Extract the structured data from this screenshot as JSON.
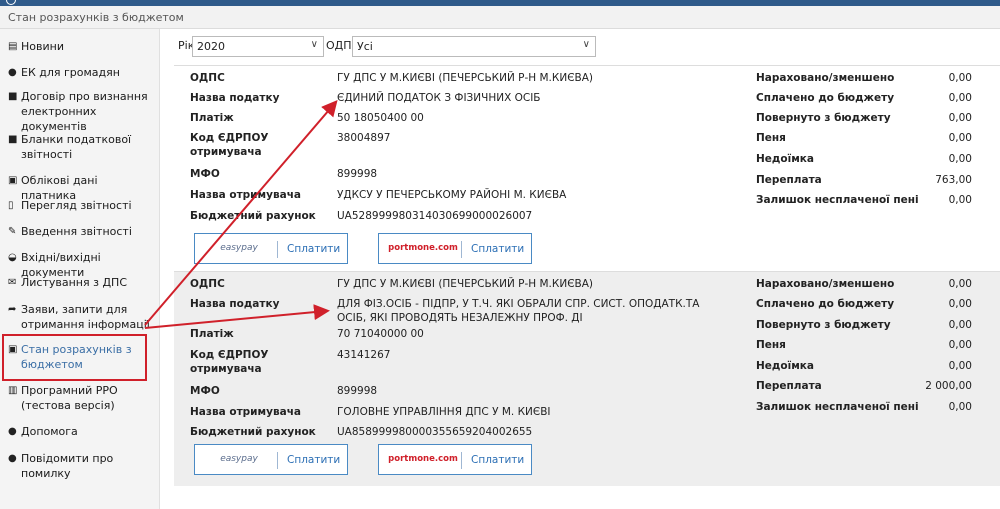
{
  "app": {
    "page_title": "Стан розрахунків з бюджетом"
  },
  "sidebar": {
    "items": [
      {
        "label": "Новини",
        "icon": "newspaper-icon"
      },
      {
        "label": "ЕК для громадян",
        "icon": "user-icon"
      },
      {
        "label": "Договір про визнання електронних документів",
        "icon": "document-icon"
      },
      {
        "label": "Бланки податкової звітності",
        "icon": "book-icon"
      },
      {
        "label": "Облікові дані платника",
        "icon": "id-card-icon"
      },
      {
        "label": "Перегляд звітності",
        "icon": "file-icon"
      },
      {
        "label": "Введення звітності",
        "icon": "edit-icon"
      },
      {
        "label": "Вхідні/вихідні документи",
        "icon": "inbox-icon"
      },
      {
        "label": "Листування з ДПС",
        "icon": "envelope-icon"
      },
      {
        "label": "Заяви, запити для отримання інформації",
        "icon": "share-icon"
      },
      {
        "label": "Стан розрахунків з бюджетом",
        "icon": "money-icon"
      },
      {
        "label": "Програмний РРО (тестова версія)",
        "icon": "printer-icon"
      },
      {
        "label": "Допомога",
        "icon": "question-icon"
      },
      {
        "label": "Повідомити про помилку",
        "icon": "info-icon"
      }
    ]
  },
  "filters": {
    "year_label": "Рік",
    "year_value": "2020",
    "odps_label": "ОДПС",
    "odps_value": "Усі"
  },
  "labels": {
    "odps": "ОДПС",
    "tax_name": "Назва податку",
    "payment": "Платіж",
    "edrpou": "Код ЄДРПОУ отримувача",
    "mfo": "МФО",
    "recipient": "Назва отримувача",
    "account": "Бюджетний рахунок",
    "accrued": "Нараховано/зменшено",
    "paid": "Сплачено до бюджету",
    "returned": "Повернуто з бюджету",
    "penalty": "Пеня",
    "arrears": "Недоїмка",
    "overpayment": "Переплата",
    "unpaid_penalty": "Залишок несплаченої пені"
  },
  "payment": {
    "easypay_logo": "easypay",
    "portmone_logo": "portmone.com",
    "pay_button": "Сплатити"
  },
  "records": [
    {
      "odps": "ГУ ДПС У М.КИЄВІ (ПЕЧЕРСЬКИЙ Р-Н М.КИЄВА)",
      "tax_name": "ЄДИНИЙ ПОДАТОК З ФІЗИЧНИХ ОСІБ",
      "payment": "50 18050400 00",
      "edrpou": "38004897",
      "mfo": "899998",
      "recipient": "УДКСУ У ПЕЧЕРСЬКОМУ РАЙОНІ М. КИЄВА",
      "account": "UA528999980314030699000026007",
      "accrued": "0,00",
      "paid": "0,00",
      "returned": "0,00",
      "penalty": "0,00",
      "arrears": "0,00",
      "overpayment": "763,00",
      "unpaid_penalty": "0,00"
    },
    {
      "odps": "ГУ ДПС У М.КИЄВІ (ПЕЧЕРСЬКИЙ Р-Н М.КИЄВА)",
      "tax_name": "ДЛЯ ФІЗ.ОСІБ - ПІДПР, У Т.Ч. ЯКІ ОБРАЛИ СПР. СИСТ. ОПОДАТК.ТА ОСІБ, ЯКІ ПРОВОДЯТЬ НЕЗАЛЕЖНУ ПРОФ. ДІ",
      "payment": "70 71040000 00",
      "edrpou": "43141267",
      "mfo": "899998",
      "recipient": "ГОЛОВНЕ УПРАВЛІННЯ ДПС У М. КИЄВІ",
      "account": "UA858999980000355659204002655",
      "accrued": "0,00",
      "paid": "0,00",
      "returned": "0,00",
      "penalty": "0,00",
      "arrears": "0,00",
      "overpayment": "2 000,00",
      "unpaid_penalty": "0,00"
    }
  ],
  "colors": {
    "accent": "#2c6fb5",
    "highlight": "#d0202a",
    "header_bar": "#2f5a8a"
  }
}
